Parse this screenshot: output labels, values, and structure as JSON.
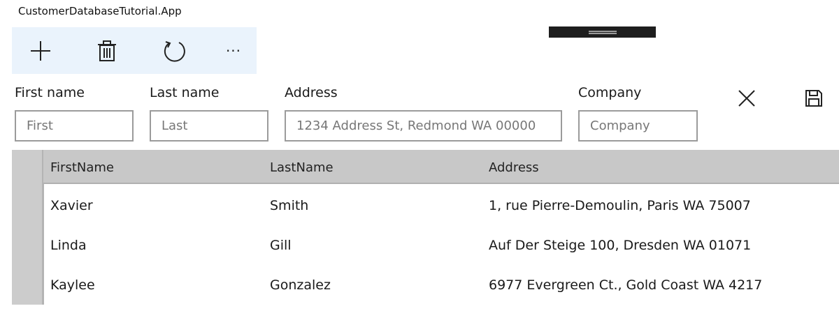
{
  "app": {
    "title": "CustomerDatabaseTutorial.App"
  },
  "toolbar": {
    "buttons": [
      {
        "name": "add",
        "icon": "plus-icon"
      },
      {
        "name": "delete",
        "icon": "trash-icon"
      },
      {
        "name": "refresh",
        "icon": "refresh-icon"
      },
      {
        "name": "more",
        "icon": "more-icon",
        "label": "···"
      }
    ],
    "background": "#eaf3fc"
  },
  "form": {
    "first_name": {
      "label": "First name",
      "placeholder": "First",
      "value": ""
    },
    "last_name": {
      "label": "Last name",
      "placeholder": "Last",
      "value": ""
    },
    "address": {
      "label": "Address",
      "placeholder": "1234 Address St, Redmond WA 00000",
      "value": ""
    },
    "company": {
      "label": "Company",
      "placeholder": "Company",
      "value": ""
    },
    "actions": [
      {
        "name": "cancel",
        "icon": "close-icon"
      },
      {
        "name": "save",
        "icon": "save-icon"
      }
    ]
  },
  "grid": {
    "columns": [
      "FirstName",
      "LastName",
      "Address"
    ],
    "rows": [
      {
        "first": "Xavier",
        "last": "Smith",
        "address": "1, rue Pierre-Demoulin, Paris WA 75007"
      },
      {
        "first": "Linda",
        "last": "Gill",
        "address": "Auf Der Steige 100, Dresden WA 01071"
      },
      {
        "first": "Kaylee",
        "last": "Gonzalez",
        "address": "6977 Evergreen Ct., Gold Coast WA 4217"
      }
    ],
    "header_color": "#c8c8c8"
  }
}
